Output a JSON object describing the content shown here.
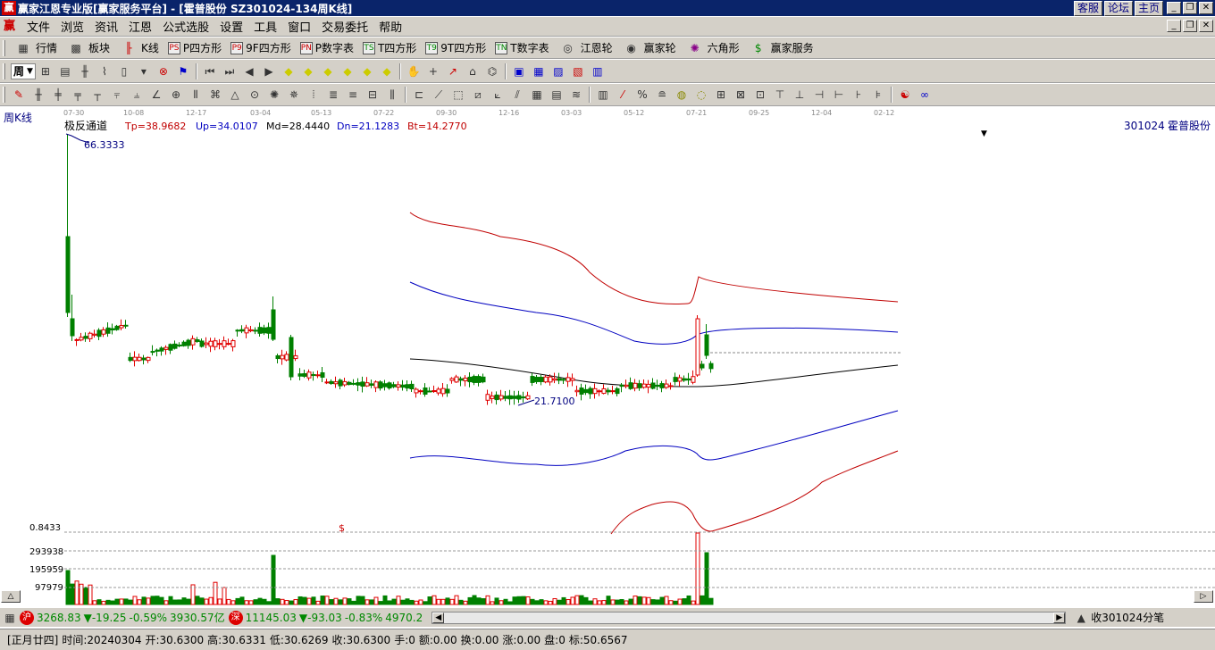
{
  "titlebar": {
    "app_logo": "赢",
    "title": "赢家江恩专业版[赢家服务平台] - [霍普股份   SZ301024-134周K线]",
    "links": [
      "客服",
      "论坛",
      "主页"
    ]
  },
  "menubar": {
    "logo": "赢",
    "items": [
      "文件",
      "浏览",
      "资讯",
      "江恩",
      "公式选股",
      "设置",
      "工具",
      "窗口",
      "交易委托",
      "帮助"
    ]
  },
  "toolbar_main": {
    "items": [
      {
        "label": "行情",
        "icon": "grid-icon"
      },
      {
        "label": "板块",
        "icon": "blocks-icon"
      },
      {
        "label": "K线",
        "icon": "candlestick-icon"
      },
      {
        "label": "P四方形",
        "icon": "P4"
      },
      {
        "label": "9F四方形",
        "icon": "P9"
      },
      {
        "label": "P数字表",
        "icon": "PN"
      },
      {
        "label": "T四方形",
        "icon": "TS"
      },
      {
        "label": "9T四方形",
        "icon": "T9"
      },
      {
        "label": "T数字表",
        "icon": "TN"
      },
      {
        "label": "江恩轮",
        "icon": "wheel-icon"
      },
      {
        "label": "赢家轮",
        "icon": "wheel-icon"
      },
      {
        "label": "六角形",
        "icon": "hexagon-icon"
      },
      {
        "label": "赢家服务",
        "icon": "dollar-icon"
      }
    ]
  },
  "period_selector": {
    "value": "周"
  },
  "chart": {
    "view_label": "周K线",
    "date_ticks": [
      "07-30",
      "10-08",
      "12-17",
      "03-04",
      "05-13",
      "07-22",
      "09-30",
      "12-16",
      "03-03",
      "05-12",
      "07-21",
      "09-25",
      "12-04",
      "02-12"
    ],
    "indicator_name": "极反通道",
    "indicators": [
      {
        "label": "Tp=38.9682",
        "color": "#c00000"
      },
      {
        "label": "Up=34.0107",
        "color": "#0000c0"
      },
      {
        "label": "Md=28.4440",
        "color": "#000000"
      },
      {
        "label": "Dn=21.1283",
        "color": "#0000c0"
      },
      {
        "label": "Bt=14.2770",
        "color": "#c00000"
      }
    ],
    "stock_code": "301024",
    "stock_name": "霍普股份",
    "high_marker": "66.3333",
    "low_marker": "21.7100",
    "volume_axis": [
      "0.8433",
      "293938",
      "195959",
      "97979"
    ],
    "dollar_marker": "$",
    "colors": {
      "up": "#e00000",
      "down": "#008000",
      "tp_bt": "#c00000",
      "up_dn": "#0000c0",
      "mid": "#000000"
    }
  },
  "chart_data": {
    "type": "candlestick",
    "period": "weekly",
    "symbol": "SZ301024",
    "title": "霍普股份",
    "indicator": "极反通道",
    "channel_latest": {
      "Tp": 38.9682,
      "Up": 34.0107,
      "Md": 28.444,
      "Dn": 21.1283,
      "Bt": 14.277
    },
    "price_high": 66.3333,
    "price_low": 21.71,
    "volume_ticks": [
      97979,
      195959,
      293938
    ]
  },
  "status_bar": {
    "sh_badge": "沪",
    "sh_index": "3268.83",
    "sh_change": "▼-19.25",
    "sh_pct": "-0.59%",
    "sh_amount": "3930.57亿",
    "sz_badge": "深",
    "sz_index": "11145.03",
    "sz_change": "▼-93.03",
    "sz_pct": "-0.83%",
    "sz_amount": "4970.2",
    "ticker_text": "收301024分笔"
  },
  "info_bar": {
    "lunar": "[正月廿四]",
    "time": "时间:20240304",
    "open": "开:30.6300",
    "high": "高:30.6331",
    "low": "低:30.6269",
    "close": "收:30.6300",
    "hand": "手:0",
    "amount": "额:0.00",
    "turnover": "换:0.00",
    "rise": "涨:0.00",
    "disk": "盘:0",
    "mark": "标:50.6567"
  }
}
